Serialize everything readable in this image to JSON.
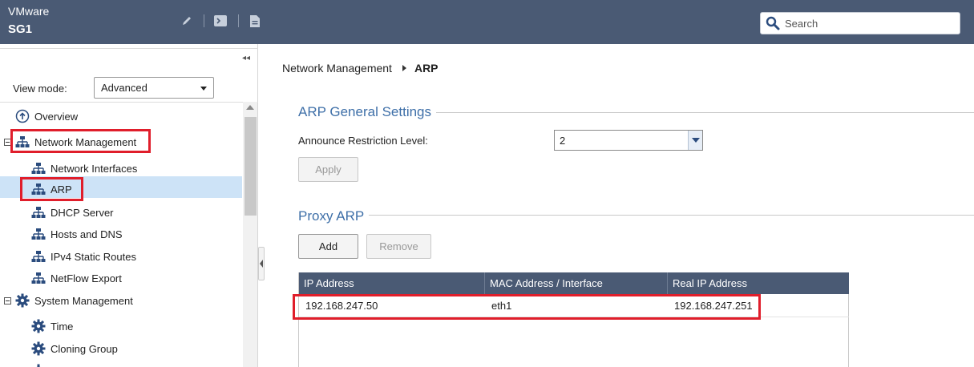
{
  "header": {
    "brand": "VMware",
    "host": "SG1",
    "toolbar_icons": [
      "pencil-icon",
      "terminal-icon",
      "document-icon"
    ],
    "search_placeholder": "Search",
    "background": "#4a5a74"
  },
  "sidebar": {
    "collapse_glyph": "◂◂",
    "view_mode_label": "View mode:",
    "view_mode_value": "Advanced",
    "items": [
      {
        "label": "Overview",
        "icon": "overview-icon"
      },
      {
        "label": "Network Management",
        "icon": "network-icon",
        "expanded": true,
        "highlighted": true
      },
      {
        "label": "Network Interfaces",
        "icon": "network-icon"
      },
      {
        "label": "ARP",
        "icon": "network-icon",
        "selected": true,
        "highlighted": true
      },
      {
        "label": "DHCP Server",
        "icon": "network-icon"
      },
      {
        "label": "Hosts and DNS",
        "icon": "network-icon"
      },
      {
        "label": "IPv4 Static Routes",
        "icon": "network-icon"
      },
      {
        "label": "NetFlow Export",
        "icon": "network-icon"
      },
      {
        "label": "System Management",
        "icon": "gear-icon",
        "expanded": true
      },
      {
        "label": "Time",
        "icon": "gear-icon"
      },
      {
        "label": "Cloning Group",
        "icon": "gear-icon"
      }
    ]
  },
  "breadcrumb": {
    "parent": "Network Management",
    "current": "ARP"
  },
  "arp_general": {
    "title": "ARP General Settings",
    "field_label": "Announce Restriction Level:",
    "field_value": "2",
    "apply_label": "Apply"
  },
  "proxy_arp": {
    "title": "Proxy ARP",
    "add_label": "Add",
    "remove_label": "Remove",
    "columns": [
      "IP Address",
      "MAC Address / Interface",
      "Real IP Address"
    ],
    "rows": [
      {
        "ip": "192.168.247.50",
        "mac": "eth1",
        "real_ip": "192.168.247.251",
        "highlighted": true
      }
    ]
  },
  "colors": {
    "accent": "#3e6fa8",
    "highlight": "#e01e2b",
    "selection": "#cde3f7"
  }
}
